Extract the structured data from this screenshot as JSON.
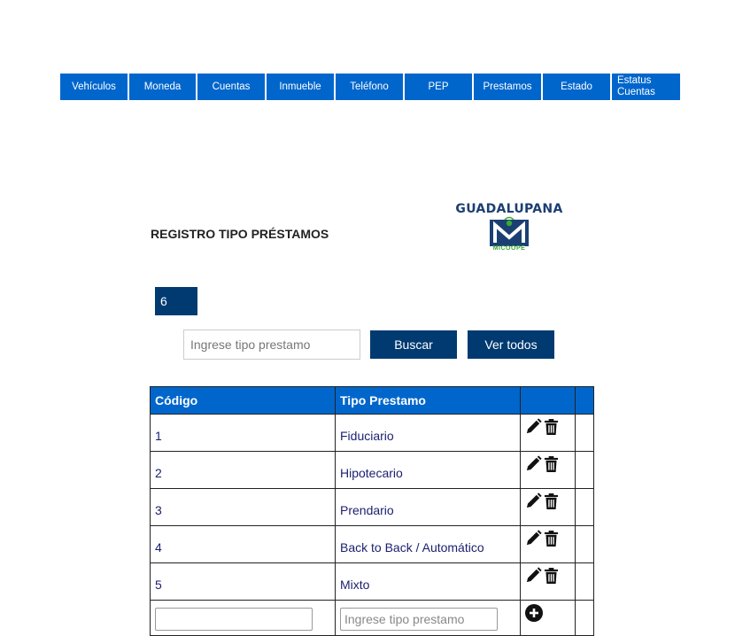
{
  "nav": {
    "items": [
      {
        "label": "Vehículos"
      },
      {
        "label": "Moneda"
      },
      {
        "label": "Cuentas"
      },
      {
        "label": "Inmueble"
      },
      {
        "label": "Teléfono"
      },
      {
        "label": "PEP"
      },
      {
        "label": "Prestamos"
      },
      {
        "label": "Estado"
      },
      {
        "label": "Estatus Cuentas"
      }
    ]
  },
  "header": {
    "title": "REGISTRO TIPO PRÉSTAMOS",
    "logo_text": "GUADALUPANA",
    "logo_sub": "MICOOPE"
  },
  "count": "6",
  "search": {
    "placeholder": "Ingrese tipo prestamo",
    "value": "",
    "buscar_label": "Buscar",
    "ver_todos_label": "Ver todos"
  },
  "table": {
    "headers": [
      "Código",
      "Tipo Prestamo",
      "",
      ""
    ],
    "rows": [
      {
        "codigo": "1",
        "tipo": "Fiduciario"
      },
      {
        "codigo": "2",
        "tipo": "Hipotecario"
      },
      {
        "codigo": "3",
        "tipo": "Prendario"
      },
      {
        "codigo": "4",
        "tipo": "Back to Back / Automático"
      },
      {
        "codigo": "5",
        "tipo": "Mixto"
      }
    ],
    "new_row": {
      "codigo_value": "",
      "tipo_placeholder": "Ingrese tipo prestamo"
    }
  },
  "icons": {
    "edit": "pencil-icon",
    "delete": "trash-icon",
    "add": "plus-circle-icon"
  },
  "colors": {
    "nav_bg": "#0066cc",
    "button_bg": "#003a70",
    "logo_blue": "#1b3f73",
    "logo_green": "#3aa935"
  }
}
